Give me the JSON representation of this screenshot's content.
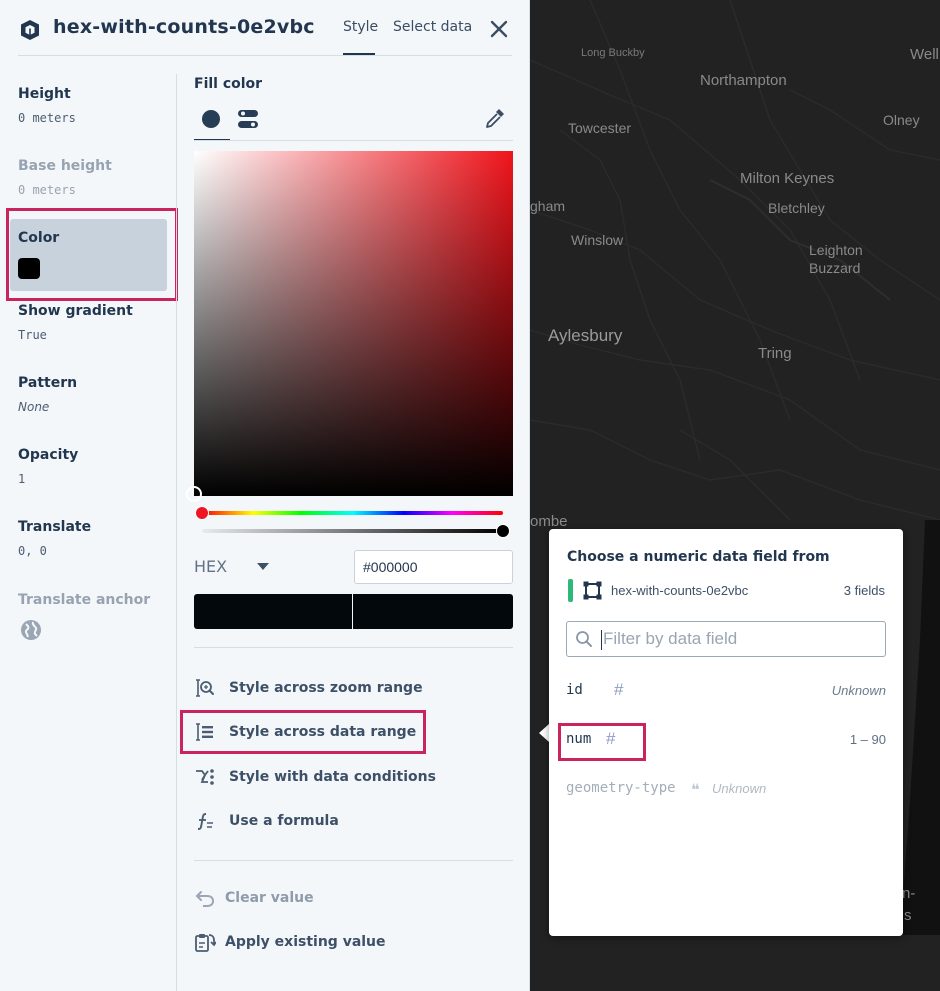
{
  "header": {
    "layer_name": "hex-with-counts-0e2vbc",
    "tabs": [
      "Style",
      "Select data"
    ],
    "active_tab": "Style"
  },
  "properties": [
    {
      "label": "Height",
      "value": "0 meters",
      "dim": false
    },
    {
      "label": "Base height",
      "value": "0 meters",
      "dim": true
    },
    {
      "label": "Color",
      "value": "",
      "swatch": "#000000",
      "selected": true
    },
    {
      "label": "Show gradient",
      "value": "True",
      "dim": false
    },
    {
      "label": "Pattern",
      "value": "None",
      "dim": false
    },
    {
      "label": "Opacity",
      "value": "1",
      "dim": false
    },
    {
      "label": "Translate",
      "value": "0, 0",
      "dim": false
    },
    {
      "label": "Translate anchor",
      "value": "",
      "icon": "globe-icon",
      "dim": true
    }
  ],
  "fill_editor": {
    "label": "Fill color",
    "hue_color": "#f0141c",
    "format_label": "HEX",
    "hex_value": "#000000",
    "preview_new": "#03080c",
    "preview_old": "#03080c"
  },
  "options": [
    {
      "label": "Style across zoom range",
      "icon": "zoom-range-icon"
    },
    {
      "label": "Style across data range",
      "icon": "data-range-icon",
      "highlighted": true
    },
    {
      "label": "Style with data conditions",
      "icon": "data-conditions-icon"
    },
    {
      "label": "Use a formula",
      "icon": "formula-icon"
    }
  ],
  "actions": [
    {
      "label": "Clear value",
      "icon": "undo-icon",
      "disabled": true
    },
    {
      "label": "Apply existing value",
      "icon": "apply-value-icon",
      "disabled": false
    }
  ],
  "field_picker": {
    "title": "Choose a numeric data field from",
    "source_name": "hex-with-counts-0e2vbc",
    "source_count": "3 fields",
    "filter_placeholder": "Filter by data field",
    "fields": [
      {
        "name": "id",
        "type": "#",
        "range": "Unknown",
        "range_italic": true,
        "disabled": false
      },
      {
        "name": "num",
        "type": "#",
        "range": "1 – 90",
        "range_italic": false,
        "disabled": false,
        "highlighted": true
      },
      {
        "name": "geometry-type",
        "type": "❝",
        "range": "Unknown",
        "range_italic": true,
        "disabled": true
      }
    ]
  },
  "map": {
    "places": [
      "Long Buckby",
      "Wellingborough",
      "Northampton",
      "Olney",
      "Towcester",
      "Milton Keynes",
      "Bletchley",
      "Buckingham",
      "Winslow",
      "Leighton Buzzard",
      "Aylesbury",
      "Tring",
      "High Wycombe",
      "Hemel Hempstead"
    ],
    "place_partials": [
      "Well",
      "gham",
      "Leighton",
      "Buzzard",
      "ombe",
      "n-",
      "s"
    ]
  }
}
